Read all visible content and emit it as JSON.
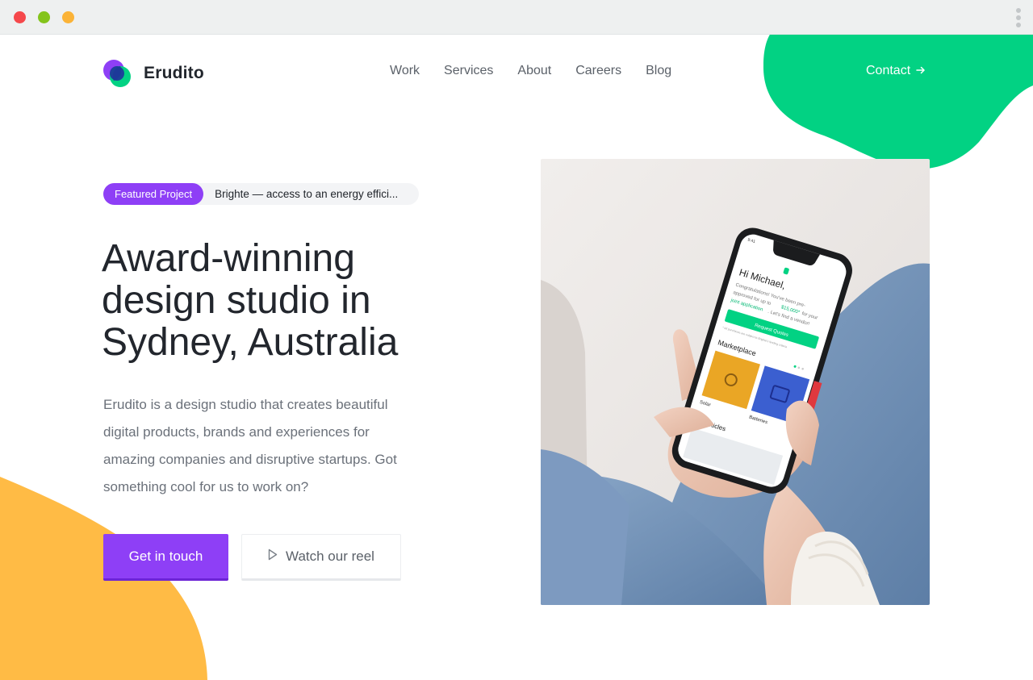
{
  "brand": {
    "name": "Erudito",
    "accent": "#8e3ff6",
    "green": "#02d283",
    "yellow": "#ffbb45"
  },
  "nav": {
    "items": [
      "Work",
      "Services",
      "About",
      "Careers",
      "Blog"
    ],
    "contact": "Contact",
    "contact_icon": "arrow-right-icon"
  },
  "hero": {
    "featured_badge": "Featured Project",
    "featured_text": "Brighte — access to an energy effici...",
    "headline_lines": [
      "Award-winning",
      "design studio in",
      "Sydney, Australia"
    ],
    "description": "Erudito is a design studio that creates beautiful digital products, brands and experiences for amazing companies and disruptive startups. Got something cool for us to work on?",
    "primary_button": "Get in touch",
    "secondary_button": "Watch our reel",
    "secondary_icon": "play-icon"
  },
  "phone_app": {
    "greeting": "Hi Michael,",
    "message_line1": "Congratulations! You've been pre-",
    "message_line2": "approved for up to",
    "amount": "$15,000*",
    "message_line3": "for your",
    "message_line4": "joint application",
    "message_line5": ". Let's find a vendor!",
    "request_button": "Request Quotes",
    "footnote": "* All purchases are subject to Brighte's lending criteria",
    "section_marketplace": "Marketplace",
    "tile_solar": "Solar",
    "tile_batteries": "Batteries",
    "tile_third": "H",
    "section_articles": "Top articles",
    "time": "9:41"
  }
}
